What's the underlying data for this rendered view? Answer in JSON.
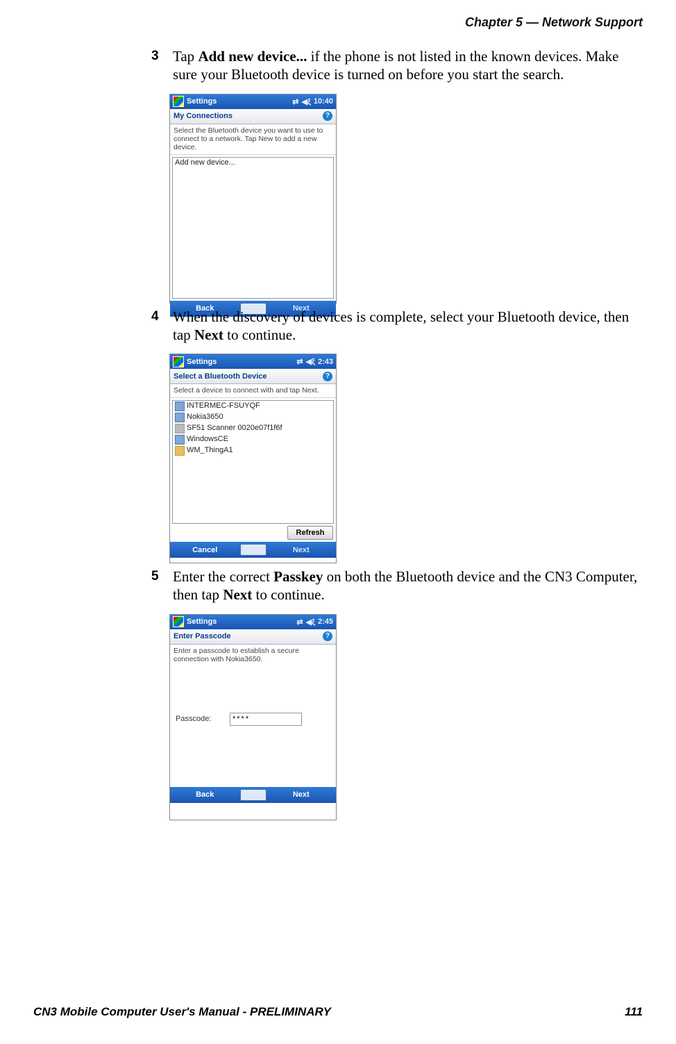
{
  "header": {
    "chapter": "Chapter 5 —  Network Support"
  },
  "steps": {
    "s3": {
      "num": "3",
      "pre": "Tap ",
      "bold1": "Add new device...",
      "post": " if the phone is not listed in the known devices. Make sure your Bluetooth device is turned on before you start the search."
    },
    "s4": {
      "num": "4",
      "pre": "When the discovery of devices is complete, select your Bluetooth device, then tap ",
      "bold1": "Next",
      "post": " to continue."
    },
    "s5": {
      "num": "5",
      "pre": "Enter the correct ",
      "bold1": "Passkey",
      "mid": " on both the Bluetooth device and the CN3 Computer, then tap ",
      "bold2": "Next",
      "post": " to continue."
    }
  },
  "shot1": {
    "title": "Settings",
    "time": "10:40",
    "subhead": "My Connections",
    "instr": "Select the Bluetooth device you want to use to connect to a network. Tap New to add a new device.",
    "list": [
      "Add new device..."
    ],
    "back": "Back",
    "next": "Next"
  },
  "shot2": {
    "title": "Settings",
    "time": "2:43",
    "subhead": "Select a Bluetooth Device",
    "instr": "Select a device to connect with and tap Next.",
    "list": [
      "INTERMEC-FSUYQF",
      "Nokia3650",
      "SF51 Scanner 0020e07f1f6f",
      "WindowsCE",
      "WM_ThingA1"
    ],
    "refresh": "Refresh",
    "cancel": "Cancel",
    "next": "Next"
  },
  "shot3": {
    "title": "Settings",
    "time": "2:45",
    "subhead": "Enter Passcode",
    "instr": "Enter a passcode to establish a secure connection with Nokia3650.",
    "passcode_label": "Passcode:",
    "passcode_value": "****",
    "back": "Back",
    "next": "Next"
  },
  "footer": {
    "left": "CN3 Mobile Computer User's Manual - PRELIMINARY",
    "right": "111"
  }
}
